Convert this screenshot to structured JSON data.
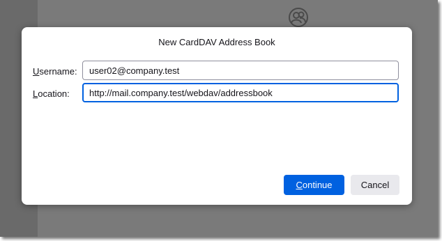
{
  "dialog": {
    "title": "New CardDAV Address Book",
    "username": {
      "label_access": "U",
      "label_rest": "sername:",
      "value": "user02@company.test"
    },
    "location": {
      "label_access": "L",
      "label_rest": "ocation:",
      "value": "http://mail.company.test/webdav/addressbook"
    },
    "continue_button": {
      "access": "C",
      "rest": "ontinue"
    },
    "cancel_button": {
      "label": "Cancel"
    }
  },
  "background": {
    "icon": "contacts-icon"
  },
  "colors": {
    "overlay": "#7a7a7a",
    "primary": "#0061e0",
    "secondary_button": "#e9e9ed"
  }
}
